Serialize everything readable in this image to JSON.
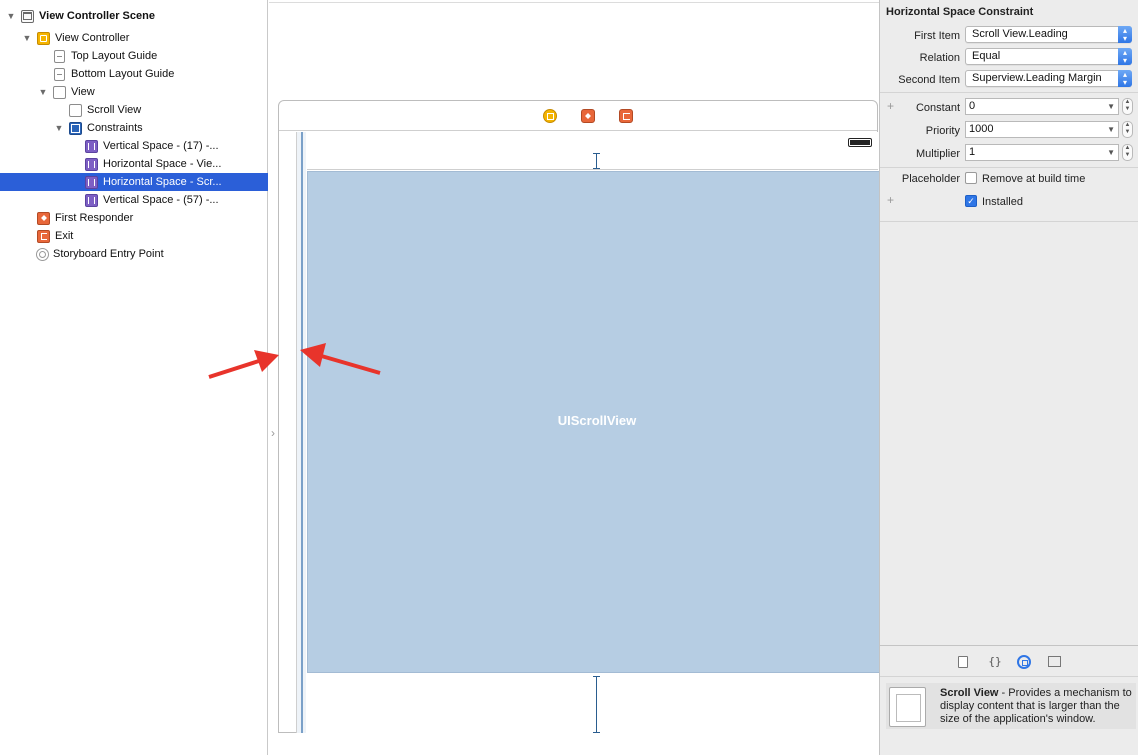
{
  "outline": {
    "items": [
      {
        "label": "View Controller Scene",
        "icon": "scene-icon",
        "depth": 0,
        "expanded": true,
        "bold": true
      },
      {
        "label": "View Controller",
        "icon": "view-controller-icon",
        "depth": 1,
        "expanded": true
      },
      {
        "label": "Top Layout Guide",
        "icon": "layout-guide-icon",
        "depth": 2
      },
      {
        "label": "Bottom Layout Guide",
        "icon": "layout-guide-icon",
        "depth": 2
      },
      {
        "label": "View",
        "icon": "view-icon",
        "depth": 2,
        "expanded": true
      },
      {
        "label": "Scroll View",
        "icon": "view-icon",
        "depth": 3
      },
      {
        "label": "Constraints",
        "icon": "constraints-icon",
        "depth": 3,
        "expanded": true
      },
      {
        "label": "Vertical Space - (17) -...",
        "icon": "constraint-icon",
        "depth": 4
      },
      {
        "label": "Horizontal Space - Vie...",
        "icon": "constraint-icon",
        "depth": 4
      },
      {
        "label": "Horizontal Space - Scr...",
        "icon": "constraint-icon",
        "depth": 4,
        "selected": true
      },
      {
        "label": "Vertical Space - (57) -...",
        "icon": "constraint-icon",
        "depth": 4
      },
      {
        "label": "First Responder",
        "icon": "first-responder-icon",
        "depth": 1
      },
      {
        "label": "Exit",
        "icon": "exit-icon",
        "depth": 1
      },
      {
        "label": "Storyboard Entry Point",
        "icon": "entry-point-icon",
        "depth": 1
      }
    ]
  },
  "canvas": {
    "dock_icons": [
      "view-controller-icon",
      "first-responder-icon",
      "exit-icon"
    ],
    "scrollview_label": "UIScrollView",
    "annotation_color": "#e8342b"
  },
  "inspector": {
    "title": "Horizontal Space Constraint",
    "first_item_label": "First Item",
    "first_item_value": "Scroll View.Leading",
    "relation_label": "Relation",
    "relation_value": "Equal",
    "second_item_label": "Second Item",
    "second_item_value": "Superview.Leading Margin",
    "constant_label": "Constant",
    "constant_value": "0",
    "priority_label": "Priority",
    "priority_value": "1000",
    "multiplier_label": "Multiplier",
    "multiplier_value": "1",
    "placeholder_label": "Placeholder",
    "remove_at_build_label": "Remove at build time",
    "remove_at_build_checked": false,
    "installed_label": "Installed",
    "installed_checked": true
  },
  "library": {
    "tabs": [
      "file-template-icon",
      "code-snippet-icon",
      "object-library-icon",
      "media-library-icon"
    ],
    "selected_tab": "object-library-icon",
    "item_title": "Scroll View",
    "item_description": " - Provides a mechanism to display content that is larger than the size of the application's window."
  },
  "colors": {
    "selection": "#2b5fd8",
    "scrollview_fill": "#b6cde3",
    "accent": "#2f76e6",
    "constraint_line": "#2a5d8f"
  }
}
